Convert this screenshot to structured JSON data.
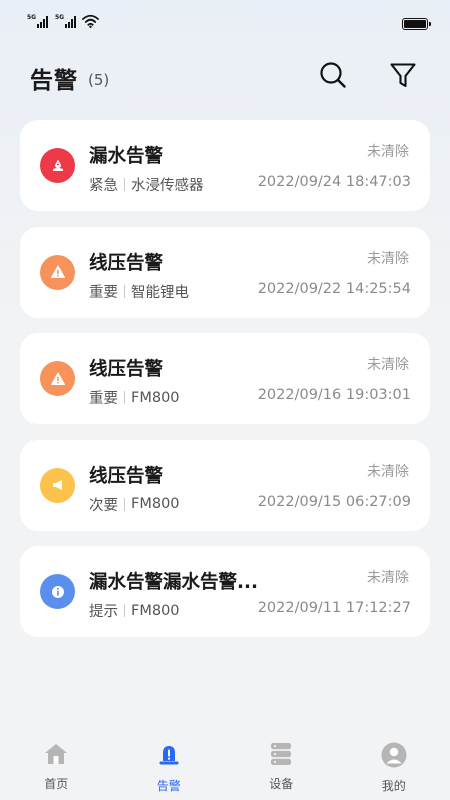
{
  "status_bar": {
    "sim1_tag": "5G",
    "sim2_tag": "5G"
  },
  "header": {
    "title": "告警",
    "count": "(5)",
    "icons": [
      "search-icon",
      "filter-icon"
    ]
  },
  "alarms": [
    {
      "title": "漏水告警",
      "status": "未清除",
      "level": "紧急",
      "source": "水浸传感器",
      "time": "2022/09/24 18:47:03",
      "icon": "water-leak-icon",
      "color": "#ee3a48"
    },
    {
      "title": "线压告警",
      "status": "未清除",
      "level": "重要",
      "source": "智能锂电",
      "time": "2022/09/22 14:25:54",
      "icon": "warning-icon",
      "color": "#f7935a"
    },
    {
      "title": "线压告警",
      "status": "未清除",
      "level": "重要",
      "source": "FM800",
      "time": "2022/09/16 19:03:01",
      "icon": "warning-icon",
      "color": "#f7935a"
    },
    {
      "title": "线压告警",
      "status": "未清除",
      "level": "次要",
      "source": "FM800",
      "time": "2022/09/15 06:27:09",
      "icon": "megaphone-icon",
      "color": "#fcc24c"
    },
    {
      "title": "漏水告警漏水告警...",
      "status": "未清除",
      "level": "提示",
      "source": "FM800",
      "time": "2022/09/11 17:12:27",
      "icon": "info-icon",
      "color": "#5a8ff0"
    }
  ],
  "tabs": [
    {
      "label": "首页",
      "icon": "home-icon",
      "active": false
    },
    {
      "label": "告警",
      "icon": "alarm-bell-icon",
      "active": true
    },
    {
      "label": "设备",
      "icon": "device-server-icon",
      "active": false
    },
    {
      "label": "我的",
      "icon": "profile-icon",
      "active": false
    }
  ],
  "colors": {
    "accent": "#2869f4",
    "inactive_tab": "#b5b5b5"
  }
}
